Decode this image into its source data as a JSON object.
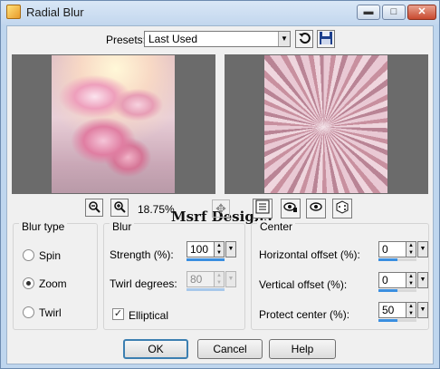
{
  "window": {
    "title": "Radial Blur"
  },
  "titlebar_buttons": {
    "minimize": "▬",
    "maximize": "□",
    "close": "✕"
  },
  "presets": {
    "label": "Presets:",
    "value": "Last Used"
  },
  "zoom": {
    "value": "18.75%"
  },
  "watermark": "Msrf Designs",
  "blur_type": {
    "title": "Blur type",
    "options": [
      {
        "label": "Spin",
        "checked": false
      },
      {
        "label": "Zoom",
        "checked": true
      },
      {
        "label": "Twirl",
        "checked": false
      }
    ]
  },
  "blur": {
    "title": "Blur",
    "strength_label": "Strength (%):",
    "strength_value": "100",
    "strength_level": 1.0,
    "twirl_label": "Twirl degrees:",
    "twirl_value": "80",
    "twirl_enabled": false,
    "elliptical_label": "Elliptical",
    "elliptical_checked": true
  },
  "center": {
    "title": "Center",
    "horizontal_label": "Horizontal offset (%):",
    "horizontal_value": "0",
    "vertical_label": "Vertical offset (%):",
    "vertical_value": "0",
    "protect_label": "Protect center (%):",
    "protect_value": "50"
  },
  "buttons": {
    "ok": "OK",
    "cancel": "Cancel",
    "help": "Help"
  },
  "icons": {
    "app": "paint-app-icon",
    "reset": "reset-icon",
    "save": "save-preset-icon",
    "zoom_out": "zoom-out-icon",
    "zoom_in": "zoom-in-icon",
    "move": "move-icon",
    "toggle_preview": "preview-toggle-icon",
    "proof": "proof-icon",
    "auto_proof": "auto-proof-icon",
    "randomize": "randomize-icon"
  },
  "colors": {
    "window_frame": "#bfd6ee",
    "accent": "#3a8fe0",
    "close": "#c84a2f"
  }
}
